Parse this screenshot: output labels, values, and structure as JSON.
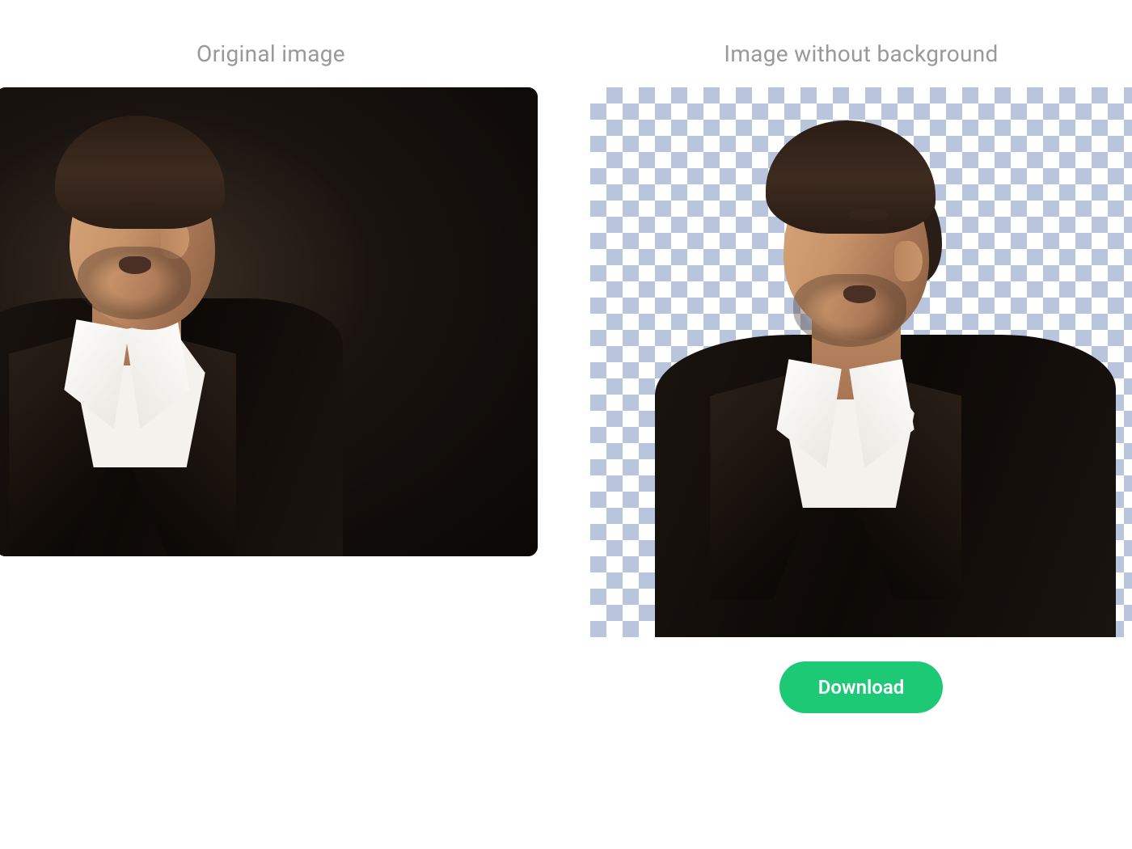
{
  "panels": {
    "original": {
      "title": "Original image"
    },
    "result": {
      "title": "Image without background"
    }
  },
  "actions": {
    "download_label": "Download"
  },
  "colors": {
    "accent": "#1ec976",
    "text_muted": "#999999",
    "checker_light": "#ffffff",
    "checker_dark": "#b8c5dd"
  }
}
